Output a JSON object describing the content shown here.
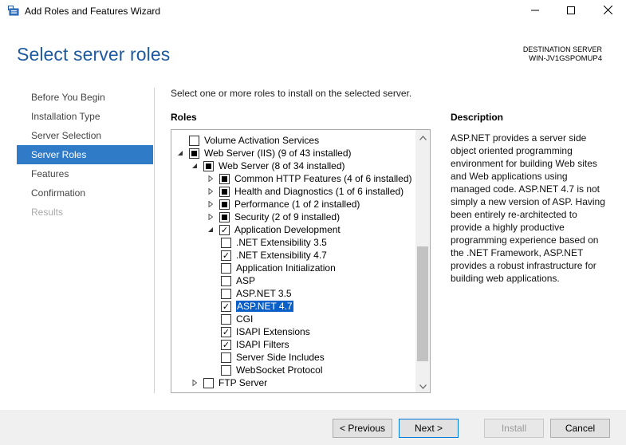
{
  "window": {
    "title": "Add Roles and Features Wizard",
    "controls": {
      "minimize_icon": "minimize-icon",
      "maximize_icon": "maximize-icon",
      "close_icon": "close-icon"
    }
  },
  "header": {
    "title": "Select server roles",
    "destination_label": "DESTINATION SERVER",
    "destination_server": "WIN-JV1GSPOMUP4"
  },
  "nav": {
    "items": [
      {
        "label": "Before You Begin",
        "state": "normal"
      },
      {
        "label": "Installation Type",
        "state": "normal"
      },
      {
        "label": "Server Selection",
        "state": "normal"
      },
      {
        "label": "Server Roles",
        "state": "active"
      },
      {
        "label": "Features",
        "state": "normal"
      },
      {
        "label": "Confirmation",
        "state": "normal"
      },
      {
        "label": "Results",
        "state": "disabled"
      }
    ]
  },
  "main": {
    "instruction": "Select one or more roles to install on the selected server.",
    "roles_heading": "Roles",
    "tree": [
      {
        "label": "Volume Activation Services",
        "level": 1,
        "expander": "none",
        "check": "unchecked"
      },
      {
        "label": "Web Server (IIS) (9 of 43 installed)",
        "level": 1,
        "expander": "expanded",
        "check": "partial"
      },
      {
        "label": "Web Server (8 of 34 installed)",
        "level": 2,
        "expander": "expanded",
        "check": "partial"
      },
      {
        "label": "Common HTTP Features (4 of 6 installed)",
        "level": 3,
        "expander": "collapsed",
        "check": "partial"
      },
      {
        "label": "Health and Diagnostics (1 of 6 installed)",
        "level": 3,
        "expander": "collapsed",
        "check": "partial"
      },
      {
        "label": "Performance (1 of 2 installed)",
        "level": 3,
        "expander": "collapsed",
        "check": "partial"
      },
      {
        "label": "Security (2 of 9 installed)",
        "level": 3,
        "expander": "collapsed",
        "check": "partial"
      },
      {
        "label": "Application Development",
        "level": 3,
        "expander": "expanded",
        "check": "checked"
      },
      {
        "label": ".NET Extensibility 3.5",
        "level": 4,
        "expander": "none",
        "check": "unchecked"
      },
      {
        "label": ".NET Extensibility 4.7",
        "level": 4,
        "expander": "none",
        "check": "checked"
      },
      {
        "label": "Application Initialization",
        "level": 4,
        "expander": "none",
        "check": "unchecked"
      },
      {
        "label": "ASP",
        "level": 4,
        "expander": "none",
        "check": "unchecked"
      },
      {
        "label": "ASP.NET 3.5",
        "level": 4,
        "expander": "none",
        "check": "unchecked"
      },
      {
        "label": "ASP.NET 4.7",
        "level": 4,
        "expander": "none",
        "check": "checked",
        "selected": true
      },
      {
        "label": "CGI",
        "level": 4,
        "expander": "none",
        "check": "unchecked"
      },
      {
        "label": "ISAPI Extensions",
        "level": 4,
        "expander": "none",
        "check": "checked"
      },
      {
        "label": "ISAPI Filters",
        "level": 4,
        "expander": "none",
        "check": "checked"
      },
      {
        "label": "Server Side Includes",
        "level": 4,
        "expander": "none",
        "check": "unchecked"
      },
      {
        "label": "WebSocket Protocol",
        "level": 4,
        "expander": "none",
        "check": "unchecked"
      },
      {
        "label": "FTP Server",
        "level": 2,
        "expander": "collapsed",
        "check": "unchecked"
      }
    ],
    "description_heading": "Description",
    "description_text": "ASP.NET provides a server side object oriented programming environment for building Web sites and Web applications using managed code. ASP.NET 4.7 is not simply a new version of ASP. Having been entirely re-architected to provide a highly productive programming experience based on the .NET Framework, ASP.NET provides a robust infrastructure for building web applications."
  },
  "footer": {
    "previous_label": "< Previous",
    "next_label": "Next >",
    "install_label": "Install",
    "cancel_label": "Cancel"
  }
}
